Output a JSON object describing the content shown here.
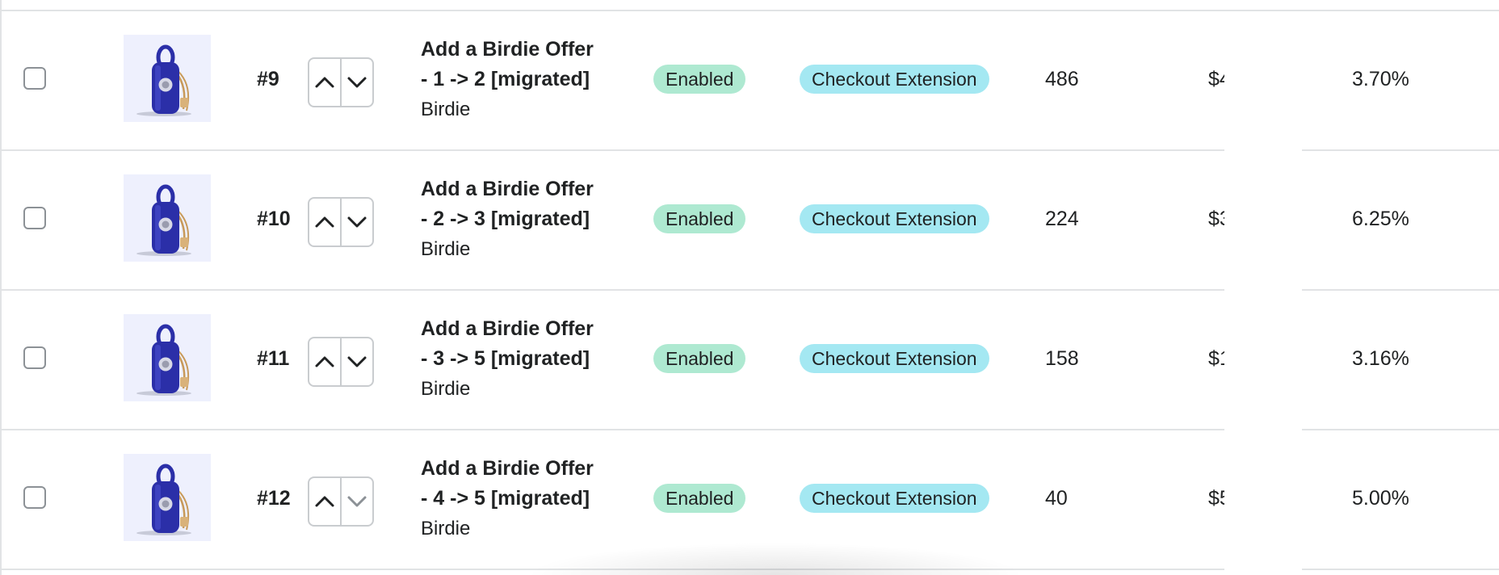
{
  "rows": [
    {
      "rank": "#9",
      "title_line1": "Add a Birdie Offer",
      "title_line2": "- 1 -> 2 [migrated]",
      "vendor": "Birdie",
      "status": "Enabled",
      "type": "Checkout Extension",
      "views": "486",
      "revenue": "$4",
      "conversion": "3.70%"
    },
    {
      "rank": "#10",
      "title_line1": "Add a Birdie Offer",
      "title_line2": "- 2 -> 3 [migrated]",
      "vendor": "Birdie",
      "status": "Enabled",
      "type": "Checkout Extension",
      "views": "224",
      "revenue": "$3",
      "conversion": "6.25%"
    },
    {
      "rank": "#11",
      "title_line1": "Add a Birdie Offer",
      "title_line2": "- 3 -> 5 [migrated]",
      "vendor": "Birdie",
      "status": "Enabled",
      "type": "Checkout Extension",
      "views": "158",
      "revenue": "$1",
      "conversion": "3.16%"
    },
    {
      "rank": "#12",
      "title_line1": "Add a Birdie Offer",
      "title_line2": "- 4 -> 5 [migrated]",
      "vendor": "Birdie",
      "status": "Enabled",
      "type": "Checkout Extension",
      "views": "40",
      "revenue": "$5",
      "conversion": "5.00%"
    }
  ],
  "icons": [
    "chevron-up-icon",
    "chevron-down-icon"
  ],
  "colors": {
    "status_badge_bg": "#aee9d1",
    "type_badge_bg": "#a4e8f2",
    "product_blue": "#2b2fa8",
    "thumb_bg": "#eef0fd",
    "border": "#e1e3e5"
  }
}
